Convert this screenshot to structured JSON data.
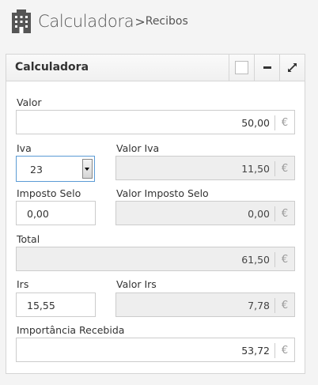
{
  "header": {
    "title": "Calculadora",
    "separator": ">",
    "subtitle": "Recibos",
    "icon": "building-icon"
  },
  "widget": {
    "title": "Calculadora",
    "buttons": [
      "checkbox-icon",
      "minimize-icon",
      "expand-icon"
    ]
  },
  "form": {
    "valor": {
      "label": "Valor",
      "value": "50,00",
      "currency": "€"
    },
    "iva": {
      "label": "Iva",
      "selected": "23"
    },
    "valor_iva": {
      "label": "Valor Iva",
      "value": "11,50",
      "currency": "€"
    },
    "imposto_selo": {
      "label": "Imposto Selo",
      "value": "0,00"
    },
    "valor_imposto_selo": {
      "label": "Valor Imposto Selo",
      "value": "0,00",
      "currency": "€"
    },
    "total": {
      "label": "Total",
      "value": "61,50",
      "currency": "€"
    },
    "irs": {
      "label": "Irs",
      "value": "15,55"
    },
    "valor_irs": {
      "label": "Valor Irs",
      "value": "7,78",
      "currency": "€"
    },
    "importancia": {
      "label": "Importância Recebida",
      "value": "53,72",
      "currency": "€"
    }
  }
}
